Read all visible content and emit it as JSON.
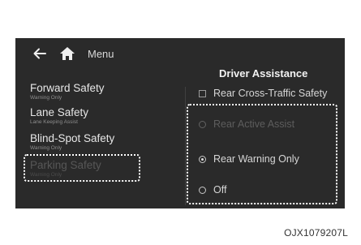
{
  "header": {
    "menu_label": "Menu",
    "back_icon": "left-arrow",
    "home_icon": "home"
  },
  "panel": {
    "title": "Driver Assistance"
  },
  "sidebar": {
    "items": [
      {
        "label": "Forward Safety",
        "sub": "Warning Only"
      },
      {
        "label": "Lane Safety",
        "sub": "Lane Keeping Assist"
      },
      {
        "label": "Blind-Spot Safety",
        "sub": "Warning Only"
      },
      {
        "label": "Parking Safety",
        "sub": "Warning Only"
      }
    ]
  },
  "options": {
    "rear_cross_traffic": {
      "label": "Rear Cross-Traffic Safety",
      "checked": false
    },
    "rear_active_assist": {
      "label": "Rear Active Assist",
      "selected": false,
      "enabled": false
    },
    "rear_warning_only": {
      "label": "Rear Warning Only",
      "selected": true
    },
    "off": {
      "label": "Off",
      "selected": false
    }
  },
  "figure_code": "OJX1079207L",
  "colors": {
    "screen_bg": "#2a2a2a",
    "highlight": "#ffffff"
  }
}
